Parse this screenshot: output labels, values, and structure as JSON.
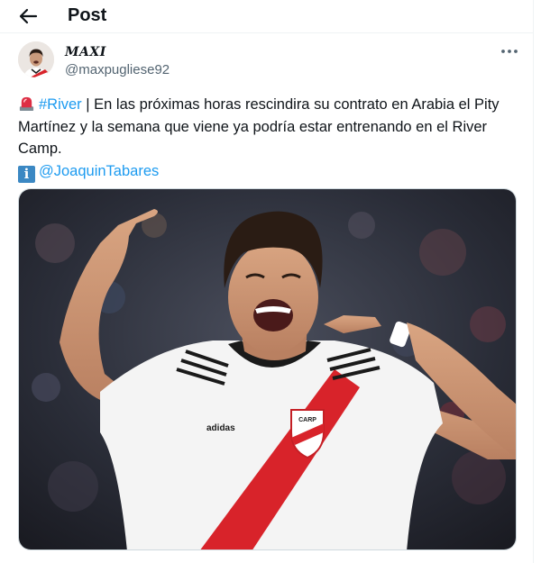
{
  "header": {
    "title": "Post",
    "back_icon": "arrow-left-icon"
  },
  "author": {
    "display_name": "MAXI",
    "handle": "@maxpugliese92",
    "more_icon": "more-horizontal-icon"
  },
  "post": {
    "siren_icon": "rotating-light-icon",
    "hashtag": "#River",
    "line1_rest": " | En las próximas horas rescindira su contrato en Arabia el Pity",
    "line2": "Martínez y la semana que viene ya podría estar entrenando en el River",
    "line3": "Camp.",
    "info_icon": "information-icon",
    "info_glyph": "i",
    "mention": "@JoaquinTabares"
  },
  "media": {
    "type": "photo",
    "jersey_brand": "adidas",
    "crest_letters": "CARP"
  },
  "colors": {
    "link": "#1d9bf0",
    "secondary_text": "#536471",
    "river_red": "#d8232a",
    "divider": "#eff3f4"
  }
}
